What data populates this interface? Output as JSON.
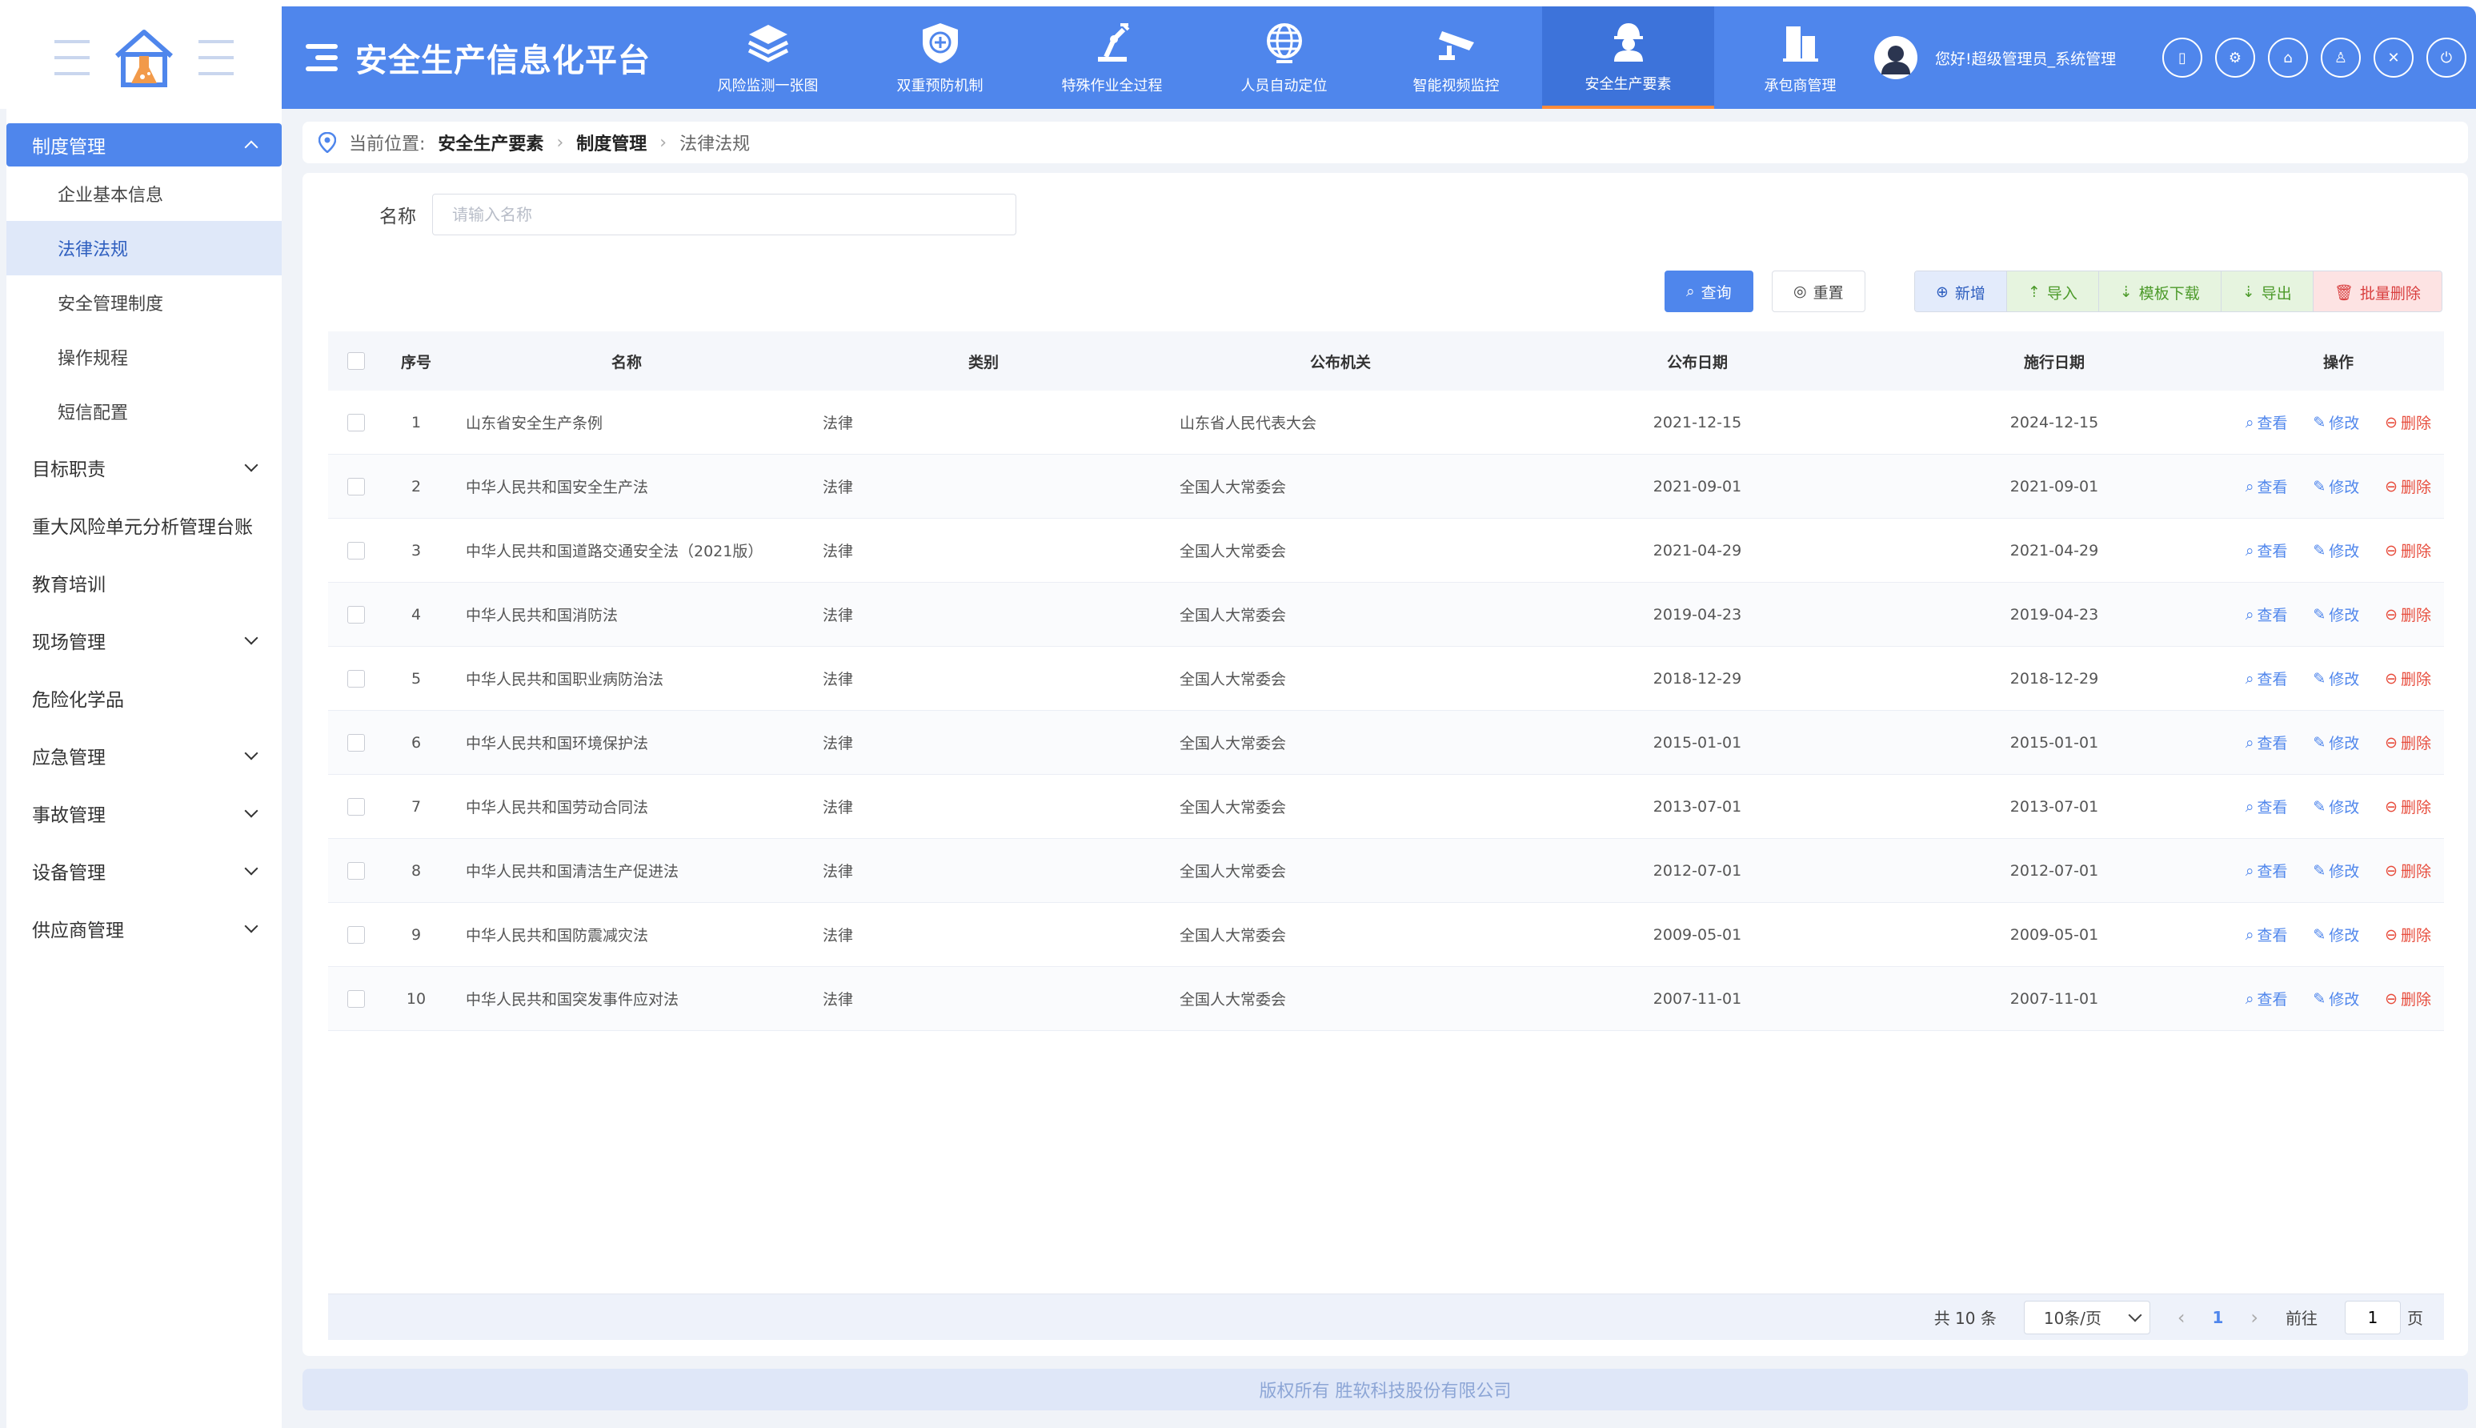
{
  "header": {
    "title": "安全生产信息化平台",
    "nav": [
      {
        "label": "风险监测一张图",
        "icon": "layers-icon"
      },
      {
        "label": "双重预防机制",
        "icon": "shield-plus-icon"
      },
      {
        "label": "特殊作业全过程",
        "icon": "robot-arm-icon"
      },
      {
        "label": "人员自动定位",
        "icon": "globe-icon"
      },
      {
        "label": "智能视频监控",
        "icon": "camera-icon"
      },
      {
        "label": "安全生产要素",
        "icon": "worker-icon"
      },
      {
        "label": "承包商管理",
        "icon": "building-icon"
      }
    ],
    "active_nav": "安全生产要素",
    "greeting": "您好!超级管理员_系统管理",
    "accent": "#4f86ec"
  },
  "sidebar": {
    "groups": [
      {
        "label": "制度管理",
        "open": true,
        "items": [
          "企业基本信息",
          "法律法规",
          "安全管理制度",
          "操作规程",
          "短信配置"
        ]
      },
      {
        "label": "目标职责",
        "open": false
      },
      {
        "label": "重大风险单元分析管理台账",
        "open": false
      },
      {
        "label": "教育培训",
        "open": false
      },
      {
        "label": "现场管理",
        "open": false
      },
      {
        "label": "危险化学品",
        "open": false
      },
      {
        "label": "应急管理",
        "open": false
      },
      {
        "label": "事故管理",
        "open": false
      },
      {
        "label": "设备管理",
        "open": false
      },
      {
        "label": "供应商管理",
        "open": false
      }
    ],
    "active_item": "法律法规"
  },
  "breadcrumb": {
    "prefix": "当前位置:",
    "items": [
      "安全生产要素",
      "制度管理",
      "法律法规"
    ]
  },
  "search": {
    "label": "名称",
    "placeholder": "请输入名称",
    "value": ""
  },
  "buttons": {
    "query": "查询",
    "reset": "重置",
    "add": "新增",
    "import": "导入",
    "template": "模板下载",
    "export": "导出",
    "batch_delete": "批量删除"
  },
  "table": {
    "columns": [
      "序号",
      "名称",
      "类别",
      "公布机关",
      "公布日期",
      "施行日期",
      "操作"
    ],
    "ops": {
      "view": "查看",
      "edit": "修改",
      "delete": "删除"
    },
    "rows": [
      {
        "idx": "1",
        "name": "山东省安全生产条例",
        "type": "法律",
        "org": "山东省人民代表大会",
        "pub": "2021-12-15",
        "eff": "2024-12-15"
      },
      {
        "idx": "2",
        "name": "中华人民共和国安全生产法",
        "type": "法律",
        "org": "全国人大常委会",
        "pub": "2021-09-01",
        "eff": "2021-09-01"
      },
      {
        "idx": "3",
        "name": "中华人民共和国道路交通安全法（2021版）",
        "type": "法律",
        "org": "全国人大常委会",
        "pub": "2021-04-29",
        "eff": "2021-04-29"
      },
      {
        "idx": "4",
        "name": "中华人民共和国消防法",
        "type": "法律",
        "org": "全国人大常委会",
        "pub": "2019-04-23",
        "eff": "2019-04-23"
      },
      {
        "idx": "5",
        "name": "中华人民共和国职业病防治法",
        "type": "法律",
        "org": "全国人大常委会",
        "pub": "2018-12-29",
        "eff": "2018-12-29"
      },
      {
        "idx": "6",
        "name": "中华人民共和国环境保护法",
        "type": "法律",
        "org": "全国人大常委会",
        "pub": "2015-01-01",
        "eff": "2015-01-01"
      },
      {
        "idx": "7",
        "name": "中华人民共和国劳动合同法",
        "type": "法律",
        "org": "全国人大常委会",
        "pub": "2013-07-01",
        "eff": "2013-07-01"
      },
      {
        "idx": "8",
        "name": "中华人民共和国清洁生产促进法",
        "type": "法律",
        "org": "全国人大常委会",
        "pub": "2012-07-01",
        "eff": "2012-07-01"
      },
      {
        "idx": "9",
        "name": "中华人民共和国防震减灾法",
        "type": "法律",
        "org": "全国人大常委会",
        "pub": "2009-05-01",
        "eff": "2009-05-01"
      },
      {
        "idx": "10",
        "name": "中华人民共和国突发事件应对法",
        "type": "法律",
        "org": "全国人大常委会",
        "pub": "2007-11-01",
        "eff": "2007-11-01"
      }
    ]
  },
  "pagination": {
    "total": "共 10 条",
    "page_size": "10条/页",
    "current_page": "1",
    "goto_label": "前往",
    "goto_value": "1",
    "page_suffix": "页"
  },
  "footer": "版权所有 胜软科技股份有限公司"
}
